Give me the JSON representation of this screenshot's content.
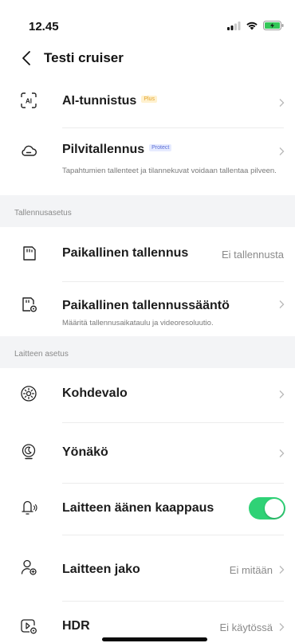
{
  "status_bar": {
    "time": "12.45"
  },
  "header": {
    "title": "Testi cruiser"
  },
  "rows": [
    {
      "label": "AI-tunnistus",
      "badge": "Plus"
    },
    {
      "label": "Pilvitallennus",
      "badge": "Protect",
      "subtitle": "Tapahtumien tallenteet ja tilannekuvat voidaan tallentaa pilveen."
    }
  ],
  "sections": [
    {
      "title": "Tallennusasetus"
    },
    {
      "title": "Laitteen asetus"
    }
  ],
  "recording": [
    {
      "label": "Paikallinen tallennus",
      "value": "Ei tallennusta"
    },
    {
      "label": "Paikallinen tallennussääntö",
      "subtitle": "Määritä tallennusaikataulu ja videoresoluutio."
    }
  ],
  "device": [
    {
      "label": "Kohdevalo"
    },
    {
      "label": "Yönäkö"
    },
    {
      "label": "Laitteen äänen kaappaus",
      "toggle_on": true
    },
    {
      "label": "Laitteen jako",
      "value": "Ei mitään"
    },
    {
      "label": "HDR",
      "value": "Ei käytössä"
    }
  ],
  "colors": {
    "toggle_on": "#2fd276",
    "section_bg": "#f3f4f6",
    "plus_badge": "#e2a42a",
    "protect_badge": "#5b6ed6"
  },
  "icons": [
    "back-chevron-icon",
    "ai-scan-icon",
    "cloud-icon",
    "sd-card-icon",
    "sd-card-settings-icon",
    "spotlight-icon",
    "night-vision-icon",
    "microphone-icon",
    "share-users-icon",
    "hdr-icon",
    "chevron-right-icon"
  ]
}
